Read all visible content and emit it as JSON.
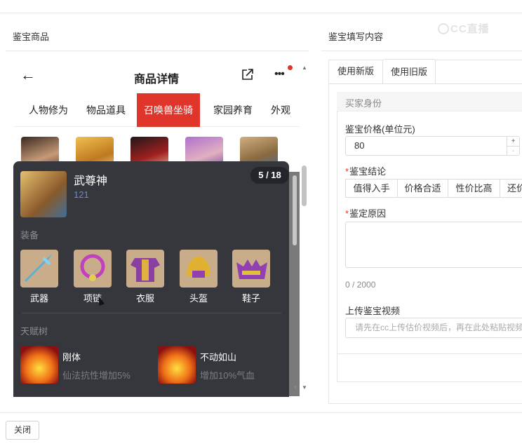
{
  "left_section_title": "鉴宝商品",
  "right_section_title": "鉴宝填写内容",
  "watermark": "CC直播",
  "phone": {
    "title": "商品详情",
    "tabs": [
      "人物修为",
      "物品道具",
      "召唤兽坐骑",
      "家园养育",
      "外观"
    ],
    "active_tab": "召唤兽坐骑"
  },
  "panel": {
    "name": "武尊神",
    "number": "121",
    "counter": "5 / 18",
    "equip_title": "装备",
    "equip": [
      "武器",
      "项链",
      "衣服",
      "头盔",
      "鞋子"
    ],
    "talent_title": "天赋树",
    "talents": [
      {
        "name": "刚体",
        "desc": "仙法抗性增加5%"
      },
      {
        "name": "不动如山",
        "desc": "增加10%气血"
      }
    ]
  },
  "form": {
    "tabs": [
      "使用新版",
      "使用旧版"
    ],
    "active_tab": "使用旧版",
    "buyer_header": "买家身份",
    "price_label": "鉴宝价格(单位元)",
    "price_value": "80",
    "stepper_plus": "+",
    "stepper_minus": "-",
    "conclusion_label": "鉴宝结论",
    "conclusion_options": [
      "值得入手",
      "价格合适",
      "性价比高",
      "还价"
    ],
    "reason_label": "鉴定原因",
    "char_count": "0 / 2000",
    "video_label": "上传鉴宝视频",
    "video_placeholder": "请先在cc上传估价视频后，再在此处粘贴视频"
  },
  "close_button": "关闭",
  "colors": {
    "accent": "#e0352b",
    "panel_bg": "#35373c",
    "link_blue": "#5f8fdc"
  }
}
